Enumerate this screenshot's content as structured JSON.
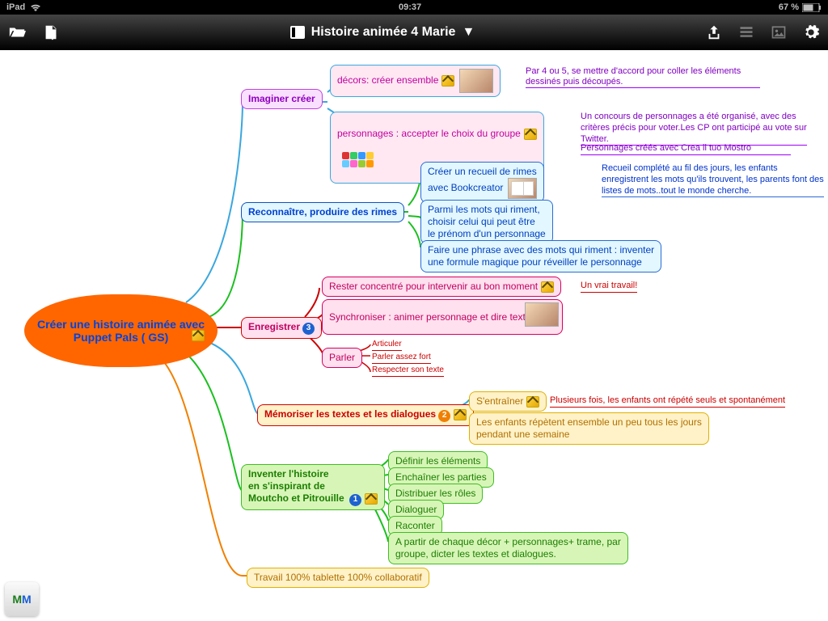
{
  "status": {
    "device": "iPad",
    "time": "09:37",
    "battery": "67 %"
  },
  "toolbar": {
    "title": "Histoire animée 4 Marie"
  },
  "root": {
    "label": "Créer une histoire animée\navec Puppet Pals\n( GS)"
  },
  "b1": {
    "label": "Imaginer créer",
    "n1": {
      "label": "décors: créer ensemble",
      "note": "Par 4 ou 5, se mettre d'accord pour coller les éléments\ndessinés puis découpés."
    },
    "n2": {
      "label": "personnages : accepter le choix du groupe",
      "note1": "Un concours de personnages a été organisé, avec des\ncritères précis pour voter.Les CP ont participé au vote sur\nTwitter.",
      "note2": "Personnages créés avec Crea il tuo Mostro"
    }
  },
  "b2": {
    "label": "Reconnaître, produire des rimes",
    "n1": {
      "label": "Créer un recueil de rimes\navec Bookcreator",
      "note": "Recueil complété au fil des jours, les enfants enregistrent\nles mots qu'ils trouvent, les parents font des listes de\nmots..tout le monde cherche."
    },
    "n2": {
      "label": "Parmi les mots qui riment,\nchoisir celui qui peut être\nle prénom d'un personnage"
    },
    "n3": {
      "label": "Faire une  phrase avec des mots qui riment : inventer\nune formule magique pour réveiller le personnage"
    }
  },
  "b3": {
    "label": "Enregistrer",
    "n1": {
      "label": "Rester concentré pour intervenir  au bon moment",
      "note": "Un vrai travail!"
    },
    "n2": {
      "label": "Synchroniser : animer personnage  et dire texte"
    },
    "n4": {
      "label": "Parler",
      "c1": "Articuler",
      "c2": "Parler assez fort",
      "c3": "Respecter son texte"
    }
  },
  "b4": {
    "label": "Mémoriser les textes et les dialogues",
    "n1": {
      "label": "S'entraîner",
      "note": "Plusieurs fois, les enfants ont répété seuls et spontanément"
    },
    "n2": {
      "label": "Les enfants répètent ensemble un peu tous les jours\npendant une semaine"
    }
  },
  "b5": {
    "label": "Inventer l'histoire\nen s'inspirant de\nMoutcho et Pitrouille",
    "c1": "Définir les éléments",
    "c2": "Enchaîner les parties",
    "c3": "Distribuer les rôles",
    "c4": "Dialoguer",
    "c5": "Raconter",
    "c6": "A partir de chaque décor + personnages+ trame, par\ngroupe, dicter les textes et dialogues."
  },
  "b6": {
    "label": "Travail 100% tablette 100% collaboratif"
  }
}
